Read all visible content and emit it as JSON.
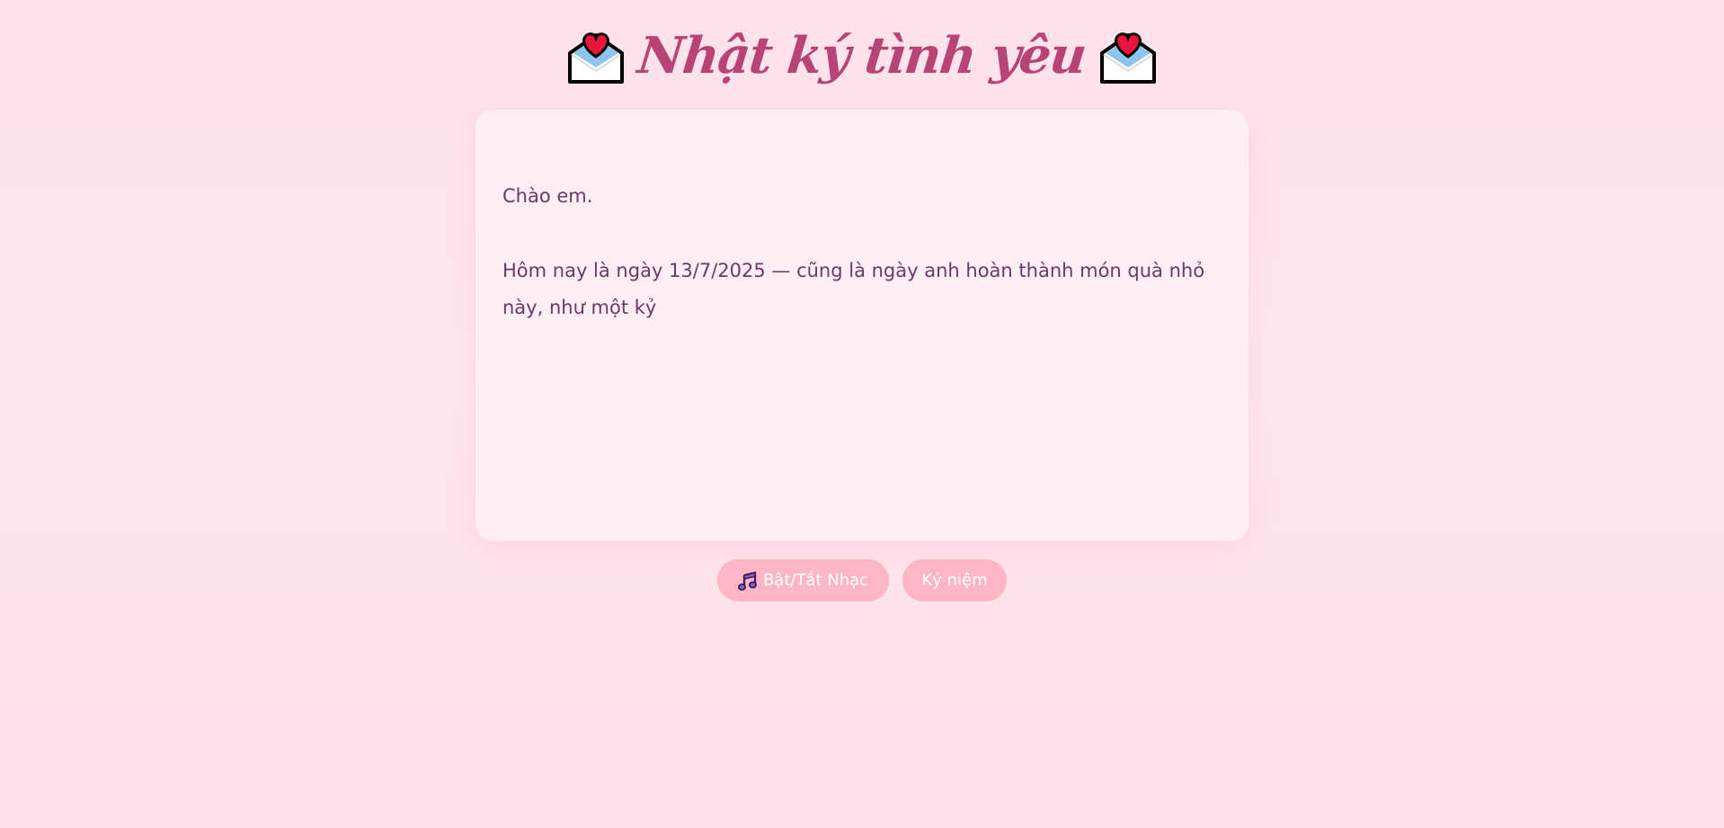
{
  "page": {
    "title": "Nhật ký tình yêu",
    "title_icon_left": "love-letter-icon",
    "title_icon_right": "love-letter-icon"
  },
  "letter": {
    "greeting": "Chào em.",
    "body": "Hôm nay là ngày 13/7/2025 — cũng là ngày anh hoàn thành món quà nhỏ này, như một kỷ"
  },
  "controls": {
    "music_icon": "music-note-icon",
    "music_label": "Bật/Tắt Nhạc",
    "memories_label": "Kỷ niệm"
  },
  "colors": {
    "background": "#ffe3eb",
    "title": "#b84375",
    "card": "#ffeef3",
    "text": "#6a3a66",
    "button": "#ffb6c4"
  }
}
